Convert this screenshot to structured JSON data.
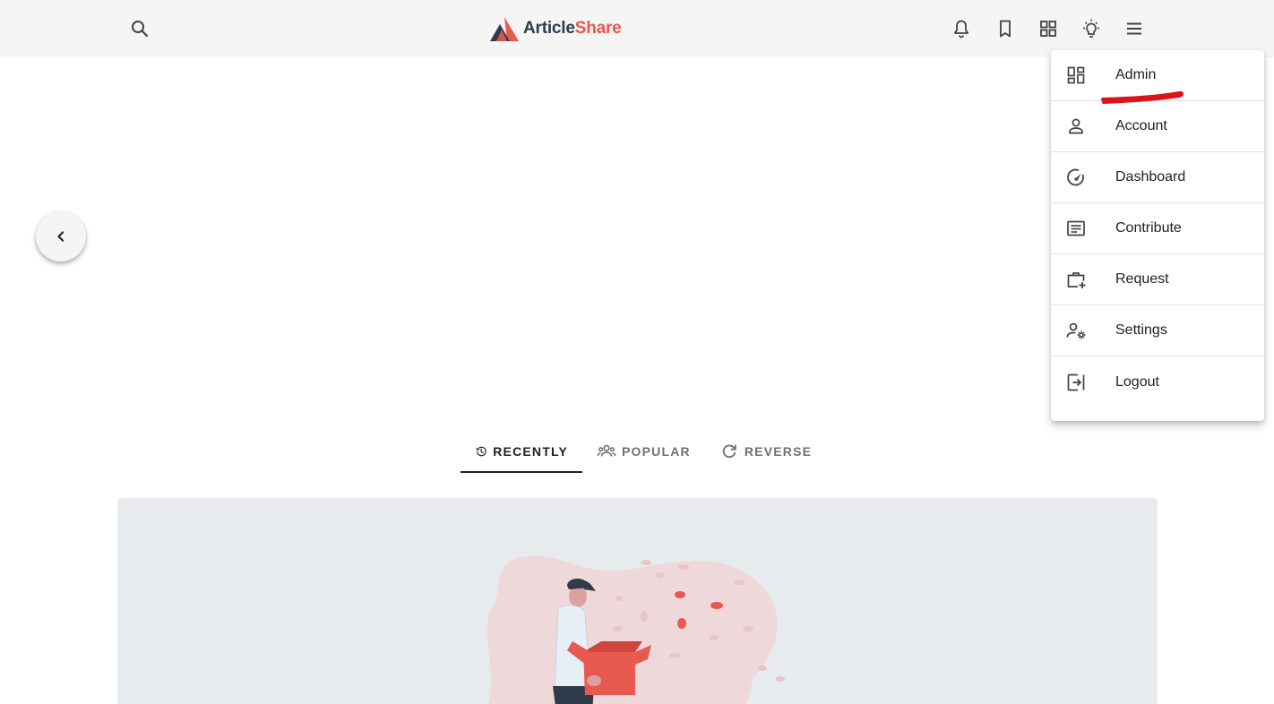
{
  "header": {
    "logo_text_dark": "Article",
    "logo_text_accent": "Share",
    "icons": [
      "search-icon",
      "notifications-icon",
      "bookmark-icon",
      "apps-grid-icon",
      "theme-lightbulb-icon",
      "menu-icon"
    ]
  },
  "back_button": {
    "icon": "chevron-left-icon"
  },
  "tabs": [
    {
      "label": "RECENTLY",
      "icon": "history-icon",
      "active": true
    },
    {
      "label": "POPULAR",
      "icon": "people-icon",
      "active": false
    },
    {
      "label": "REVERSE",
      "icon": "refresh-icon",
      "active": false
    }
  ],
  "menu": {
    "items": [
      {
        "label": "Admin",
        "icon": "dashboard-grid-icon"
      },
      {
        "label": "Account",
        "icon": "person-icon"
      },
      {
        "label": "Dashboard",
        "icon": "speedometer-icon"
      },
      {
        "label": "Contribute",
        "icon": "article-icon"
      },
      {
        "label": "Request",
        "icon": "work-add-icon"
      },
      {
        "label": "Settings",
        "icon": "manage-accounts-icon"
      },
      {
        "label": "Logout",
        "icon": "logout-icon"
      }
    ]
  },
  "colors": {
    "header_bg": "#f5f5f5",
    "brand_dark": "#2f3a4b",
    "brand_accent": "#e85a4f",
    "card_bg": "#e8ebee",
    "annotation_red": "#d9141b"
  }
}
